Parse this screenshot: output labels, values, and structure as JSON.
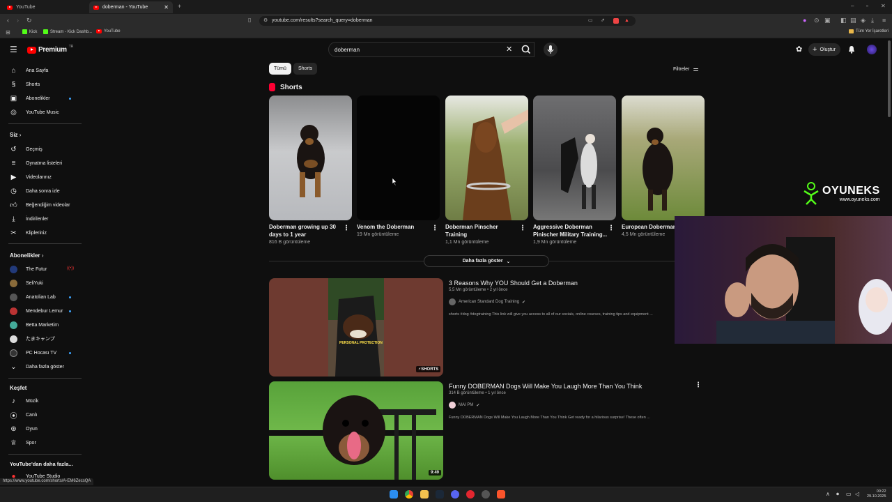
{
  "browser": {
    "tabs": [
      {
        "label": "YouTube"
      },
      {
        "label": "doberman - YouTube"
      }
    ],
    "url": "youtube.com/results?search_query=doberman",
    "bookmarks": [
      "Kick",
      "Stream - Kick Dashb...",
      "YouTube"
    ],
    "other_bookmarks": "Tüm Yer İşaretleri",
    "status_url": "https://www.youtube.com/shorts/A-EM6ZecsQA"
  },
  "header": {
    "logo_text": "Premium",
    "logo_sup": "TR",
    "search_value": "doberman",
    "create_label": "Oluştur"
  },
  "sidebar": {
    "main": [
      "Ana Sayfa",
      "Shorts",
      "Abonelikler",
      "YouTube Music"
    ],
    "you_heading": "Siz",
    "you": [
      "Geçmiş",
      "Oynatma listeleri",
      "Videolarınız",
      "Daha sonra izle",
      "Beğendiğim videolar",
      "İndirilenler",
      "Klipleriniz"
    ],
    "subs_heading": "Abonelikler",
    "subs": [
      "The Futur",
      "SeliYuki",
      "Anatolian Lab",
      "Mendebur Lemur",
      "Betta Marketim",
      "たまキャンプ",
      "PC Hocası TV"
    ],
    "show_more": "Daha fazla göster",
    "explore_heading": "Keşfet",
    "explore": [
      "Müzik",
      "Canlı",
      "Oyun",
      "Spor"
    ],
    "more_heading": "YouTube'dan daha fazla...",
    "more": [
      "YouTube Studio"
    ]
  },
  "filters": {
    "chips": [
      "Tümü",
      "Shorts"
    ],
    "filter_label": "Filtreler"
  },
  "shorts": {
    "heading": "Shorts",
    "items": [
      {
        "title1": "Doberman growing up 30",
        "title2": "days to 1 year",
        "views": "816 B görüntüleme"
      },
      {
        "title1": "Venom the Doberman",
        "title2": "",
        "views": "19 Mn görüntüleme"
      },
      {
        "title1": "Doberman Pinscher",
        "title2": "Training",
        "views": "1,1 Mn görüntüleme"
      },
      {
        "title1": "Aggressive Doberman",
        "title2": "Pinischer Military Training...",
        "views": "1,9 Mn görüntüleme"
      },
      {
        "title1": "European Doberman",
        "title2": "",
        "views": "4,5 Mn görüntüleme"
      }
    ],
    "show_more": "Daha fazla göster"
  },
  "videos": [
    {
      "title": "3 Reasons Why YOU Should Get a Doberman",
      "meta": "5,5 Mn görüntüleme • 2 yıl önce",
      "channel": "American Standard Dog Training",
      "desc": "shorts #dog #dogtraining This link will give you access to all of our socials, online courses, training tips and equipment ...",
      "badge": "SHORTS",
      "overlay": "PERSONAL PROTECTION"
    },
    {
      "title": "Funny DOBERMAN Dogs Will Make You Laugh More Than You Think",
      "meta": "314 B görüntüleme • 1 yıl önce",
      "channel": "MAI PM",
      "desc": "Funny DOBERMAN Dogs Will Make You Laugh More Than You Think Get ready for a hilarious surprise! These often ...",
      "duration": "9:49"
    }
  ],
  "overlay": {
    "brand": "OYUNEKS",
    "brand_url": "www.oyuneks.com"
  },
  "taskbar": {
    "time": "00:22",
    "date": "29.10.2025"
  },
  "colors": {
    "accent": "#ff0000",
    "bg": "#0f0f0f",
    "link": "#3ea6ff"
  }
}
